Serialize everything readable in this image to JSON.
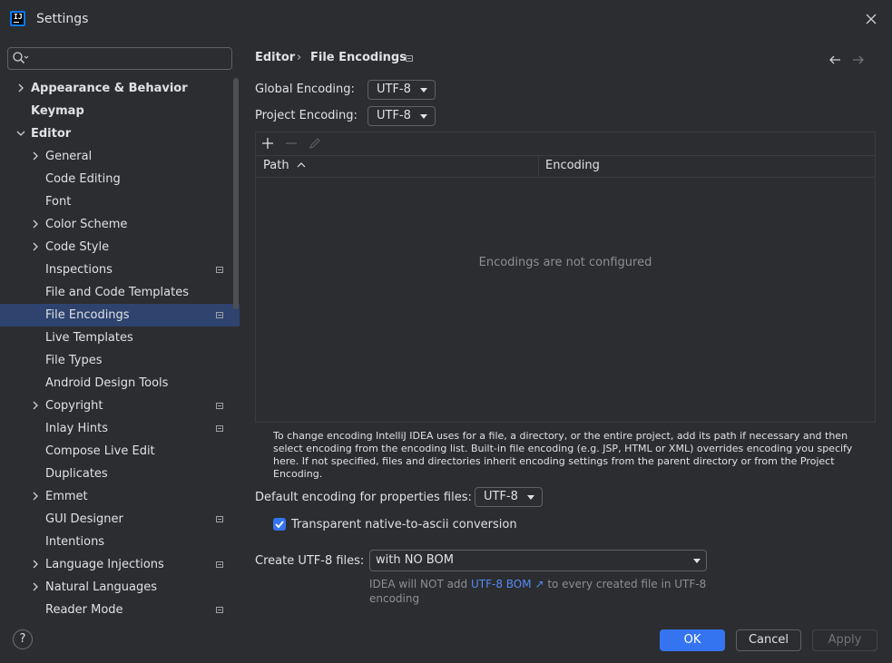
{
  "window": {
    "title": "Settings",
    "app_icon_text": "IJ"
  },
  "search": {
    "value": "",
    "placeholder": ""
  },
  "sidebar": {
    "items": [
      {
        "label": "Appearance & Behavior",
        "level": 0,
        "chevron": "right",
        "bold": true,
        "mark": false
      },
      {
        "label": "Keymap",
        "level": 0,
        "chevron": "none",
        "bold": true,
        "mark": false
      },
      {
        "label": "Editor",
        "level": 0,
        "chevron": "down",
        "bold": true,
        "mark": false
      },
      {
        "label": "General",
        "level": 1,
        "chevron": "right",
        "bold": false,
        "mark": false
      },
      {
        "label": "Code Editing",
        "level": 1,
        "chevron": "none",
        "bold": false,
        "mark": false
      },
      {
        "label": "Font",
        "level": 1,
        "chevron": "none",
        "bold": false,
        "mark": false
      },
      {
        "label": "Color Scheme",
        "level": 1,
        "chevron": "right",
        "bold": false,
        "mark": false
      },
      {
        "label": "Code Style",
        "level": 1,
        "chevron": "right",
        "bold": false,
        "mark": false
      },
      {
        "label": "Inspections",
        "level": 1,
        "chevron": "none",
        "bold": false,
        "mark": true
      },
      {
        "label": "File and Code Templates",
        "level": 1,
        "chevron": "none",
        "bold": false,
        "mark": false
      },
      {
        "label": "File Encodings",
        "level": 1,
        "chevron": "none",
        "bold": false,
        "mark": true,
        "selected": true
      },
      {
        "label": "Live Templates",
        "level": 1,
        "chevron": "none",
        "bold": false,
        "mark": false
      },
      {
        "label": "File Types",
        "level": 1,
        "chevron": "none",
        "bold": false,
        "mark": false
      },
      {
        "label": "Android Design Tools",
        "level": 1,
        "chevron": "none",
        "bold": false,
        "mark": false
      },
      {
        "label": "Copyright",
        "level": 1,
        "chevron": "right",
        "bold": false,
        "mark": true
      },
      {
        "label": "Inlay Hints",
        "level": 1,
        "chevron": "none",
        "bold": false,
        "mark": true
      },
      {
        "label": "Compose Live Edit",
        "level": 1,
        "chevron": "none",
        "bold": false,
        "mark": false
      },
      {
        "label": "Duplicates",
        "level": 1,
        "chevron": "none",
        "bold": false,
        "mark": false
      },
      {
        "label": "Emmet",
        "level": 1,
        "chevron": "right",
        "bold": false,
        "mark": false
      },
      {
        "label": "GUI Designer",
        "level": 1,
        "chevron": "none",
        "bold": false,
        "mark": true
      },
      {
        "label": "Intentions",
        "level": 1,
        "chevron": "none",
        "bold": false,
        "mark": false
      },
      {
        "label": "Language Injections",
        "level": 1,
        "chevron": "right",
        "bold": false,
        "mark": true
      },
      {
        "label": "Natural Languages",
        "level": 1,
        "chevron": "right",
        "bold": false,
        "mark": false
      },
      {
        "label": "Reader Mode",
        "level": 1,
        "chevron": "none",
        "bold": false,
        "mark": true
      }
    ]
  },
  "breadcrumb": {
    "parent": "Editor",
    "separator": "›",
    "current": "File Encodings"
  },
  "global_encoding": {
    "label": "Global Encoding:",
    "value": "UTF-8"
  },
  "project_encoding": {
    "label": "Project Encoding:",
    "value": "UTF-8"
  },
  "table": {
    "columns": [
      "Path",
      "Encoding"
    ],
    "sort_indicator": "^",
    "empty_text": "Encodings are not configured"
  },
  "help_text": "To change encoding IntelliJ IDEA uses for a file, a directory, or the entire project, add its path if necessary and then select encoding from the encoding list. Built-in file encoding (e.g. JSP, HTML or XML) overrides encoding you specify here. If not specified, files and directories inherit encoding settings from the parent directory or from the Project Encoding.",
  "properties_encoding": {
    "label": "Default encoding for properties files:",
    "value": "UTF-8"
  },
  "transparent_ascii": {
    "label": "Transparent native-to-ascii conversion",
    "checked": true
  },
  "create_utf8": {
    "label": "Create UTF-8 files:",
    "value": "with NO BOM"
  },
  "bom_note": {
    "prefix": "IDEA will NOT add ",
    "link": "UTF-8 BOM",
    "link_arrow": "↗",
    "suffix": " to every created file in UTF-8 encoding"
  },
  "buttons": {
    "help": "?",
    "ok": "OK",
    "cancel": "Cancel",
    "apply": "Apply"
  },
  "colors": {
    "accent": "#3574f0",
    "selection": "#2e436e",
    "background": "#2b2d30",
    "link": "#548af7"
  }
}
